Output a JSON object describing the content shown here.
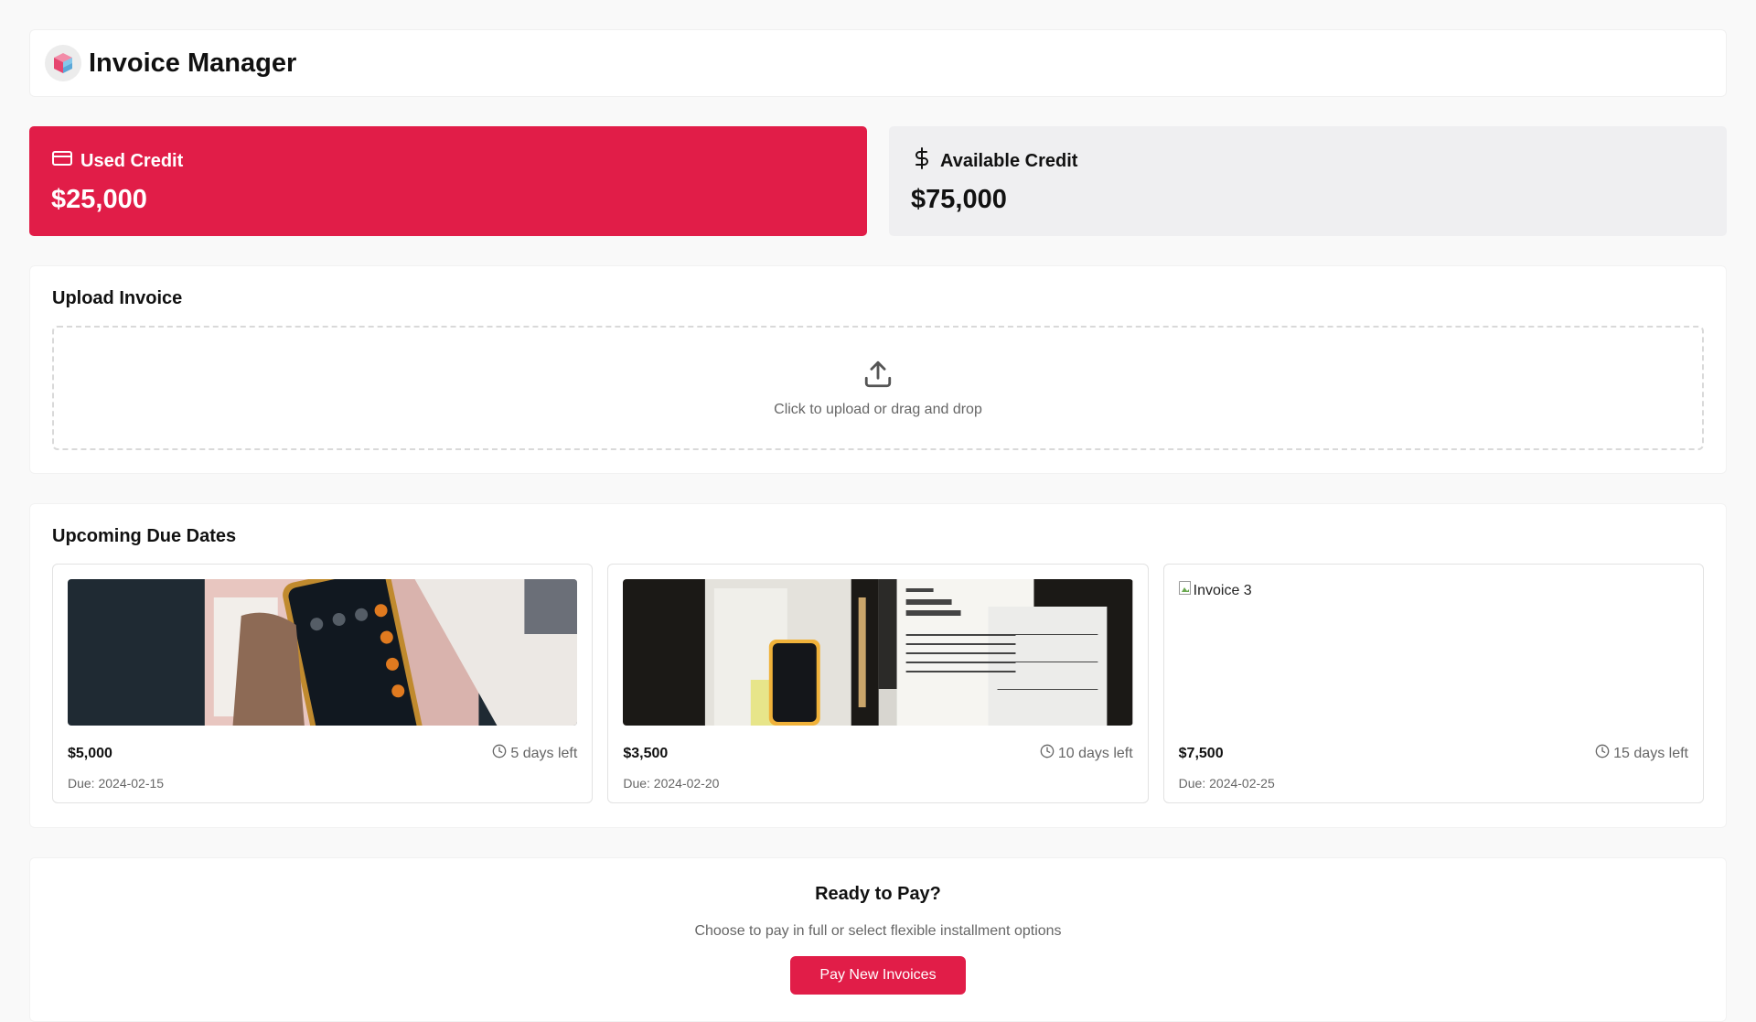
{
  "header": {
    "title": "Invoice Manager",
    "logo_icon": "cube-logo-icon"
  },
  "credits": {
    "used": {
      "label": "Used Credit",
      "amount": "$25,000",
      "icon": "credit-card-icon",
      "color": "#e11d48"
    },
    "available": {
      "label": "Available Credit",
      "amount": "$75,000",
      "icon": "dollar-sign-icon",
      "color": "#efeff1"
    }
  },
  "upload": {
    "title": "Upload Invoice",
    "prompt": "Click to upload or drag and drop",
    "icon": "upload-icon"
  },
  "due": {
    "title": "Upcoming Due Dates",
    "items": [
      {
        "amount": "$5,000",
        "days_left": "5 days left",
        "due": "Due: 2024-02-15",
        "image": "calculator-photo"
      },
      {
        "amount": "$3,500",
        "days_left": "10 days left",
        "due": "Due: 2024-02-20",
        "image": "tax-form-photo"
      },
      {
        "amount": "$7,500",
        "days_left": "15 days left",
        "due": "Due: 2024-02-25",
        "image_alt": "Invoice 3"
      }
    ]
  },
  "pay": {
    "title": "Ready to Pay?",
    "subtitle": "Choose to pay in full or select flexible installment options",
    "button": "Pay New Invoices"
  },
  "colors": {
    "accent": "#e11d48",
    "muted_text": "#666666"
  }
}
